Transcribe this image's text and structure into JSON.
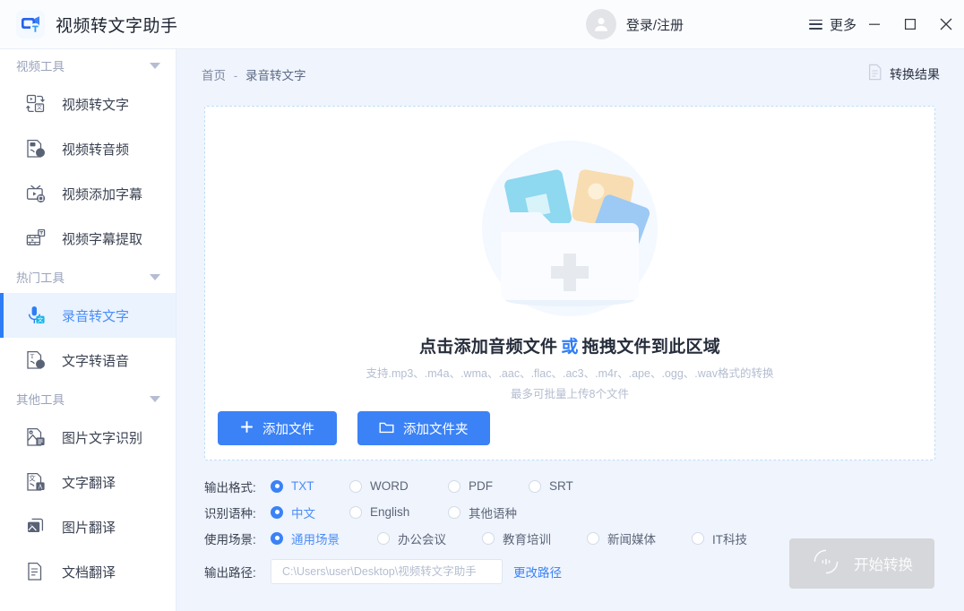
{
  "window": {
    "app_title": "视频转文字助手",
    "logo_icon": "app-logo-icon",
    "account_label": "登录/注册",
    "avatar_icon": "user-avatar-icon",
    "more_label": "更多",
    "menu_icon": "hamburger-icon",
    "minimize_icon": "minimize-icon",
    "maximize_icon": "maximize-icon",
    "close_icon": "close-icon"
  },
  "colors": {
    "accent": "#3b82f6",
    "active_item_bg": "#eaf3fe",
    "page_bg": "#eff4fd",
    "panel_bg": "#ffffff",
    "disabled_button": "#d5d7da",
    "dashed_border": "#bfddf7"
  },
  "sidebar": {
    "groups": [
      {
        "title": "视频工具",
        "caret_icon": "chevron-down-icon",
        "items": [
          {
            "label": "视频转文字",
            "icon": "video-to-text-icon",
            "active": false
          },
          {
            "label": "视频转音频",
            "icon": "video-to-audio-icon",
            "active": false
          },
          {
            "label": "视频添加字幕",
            "icon": "video-add-subtitle-icon",
            "active": false
          },
          {
            "label": "视频字幕提取",
            "icon": "video-extract-subtitle-icon",
            "active": false
          }
        ]
      },
      {
        "title": "热门工具",
        "caret_icon": "chevron-down-icon",
        "items": [
          {
            "label": "录音转文字",
            "icon": "audio-to-text-icon",
            "active": true
          },
          {
            "label": "文字转语音",
            "icon": "text-to-speech-icon",
            "active": false
          }
        ]
      },
      {
        "title": "其他工具",
        "caret_icon": "chevron-down-icon",
        "items": [
          {
            "label": "图片文字识别",
            "icon": "image-ocr-icon",
            "active": false
          },
          {
            "label": "文字翻译",
            "icon": "text-translate-icon",
            "active": false
          },
          {
            "label": "图片翻译",
            "icon": "image-translate-icon",
            "active": false
          },
          {
            "label": "文档翻译",
            "icon": "document-translate-icon",
            "active": false
          }
        ]
      }
    ]
  },
  "main": {
    "breadcrumb": {
      "home": "首页",
      "separator": "-",
      "current": "录音转文字"
    },
    "result_button": {
      "label": "转换结果",
      "icon": "document-icon"
    },
    "upload": {
      "illustration_icon": "folder-with-files-illustration",
      "title_part1": "点击添加音频文件",
      "title_or": "或",
      "title_part2": "拖拽文件到此区域",
      "formats": "支持.mp3、.m4a、.wma、.aac、.flac、.ac3、.m4r、.ape、.ogg、.wav格式的转换",
      "limit": "最多可批量上传8个文件",
      "add_file_button": {
        "label": "添加文件",
        "icon": "plus-icon"
      },
      "add_folder_button": {
        "label": "添加文件夹",
        "icon": "folder-icon"
      }
    },
    "options": [
      {
        "label": "输出格式:",
        "name": "output-format",
        "items": [
          {
            "text": "TXT",
            "selected": true
          },
          {
            "text": "WORD",
            "selected": false
          },
          {
            "text": "PDF",
            "selected": false
          },
          {
            "text": "SRT",
            "selected": false
          }
        ],
        "widths": [
          88,
          110,
          90,
          0
        ]
      },
      {
        "label": "识别语种:",
        "name": "recognition-language",
        "items": [
          {
            "text": "中文",
            "selected": true
          },
          {
            "text": "English",
            "selected": false
          },
          {
            "text": "其他语种",
            "selected": false
          }
        ],
        "widths": [
          88,
          110,
          0
        ]
      },
      {
        "label": "使用场景:",
        "name": "usage-scenario",
        "items": [
          {
            "text": "通用场景",
            "selected": true
          },
          {
            "text": "办公会议",
            "selected": false
          },
          {
            "text": "教育培训",
            "selected": false
          },
          {
            "text": "新闻媒体",
            "selected": false
          },
          {
            "text": "IT科技",
            "selected": false
          }
        ],
        "widths": [
          119,
          117,
          117,
          117,
          0
        ]
      }
    ],
    "output_path": {
      "label": "输出路径:",
      "placeholder": "C:\\Users\\user\\Desktop\\视频转文字助手",
      "value": "",
      "change_link": "更改路径"
    },
    "start_button": {
      "label": "开始转换",
      "icon": "convert-icon",
      "disabled": true
    }
  }
}
